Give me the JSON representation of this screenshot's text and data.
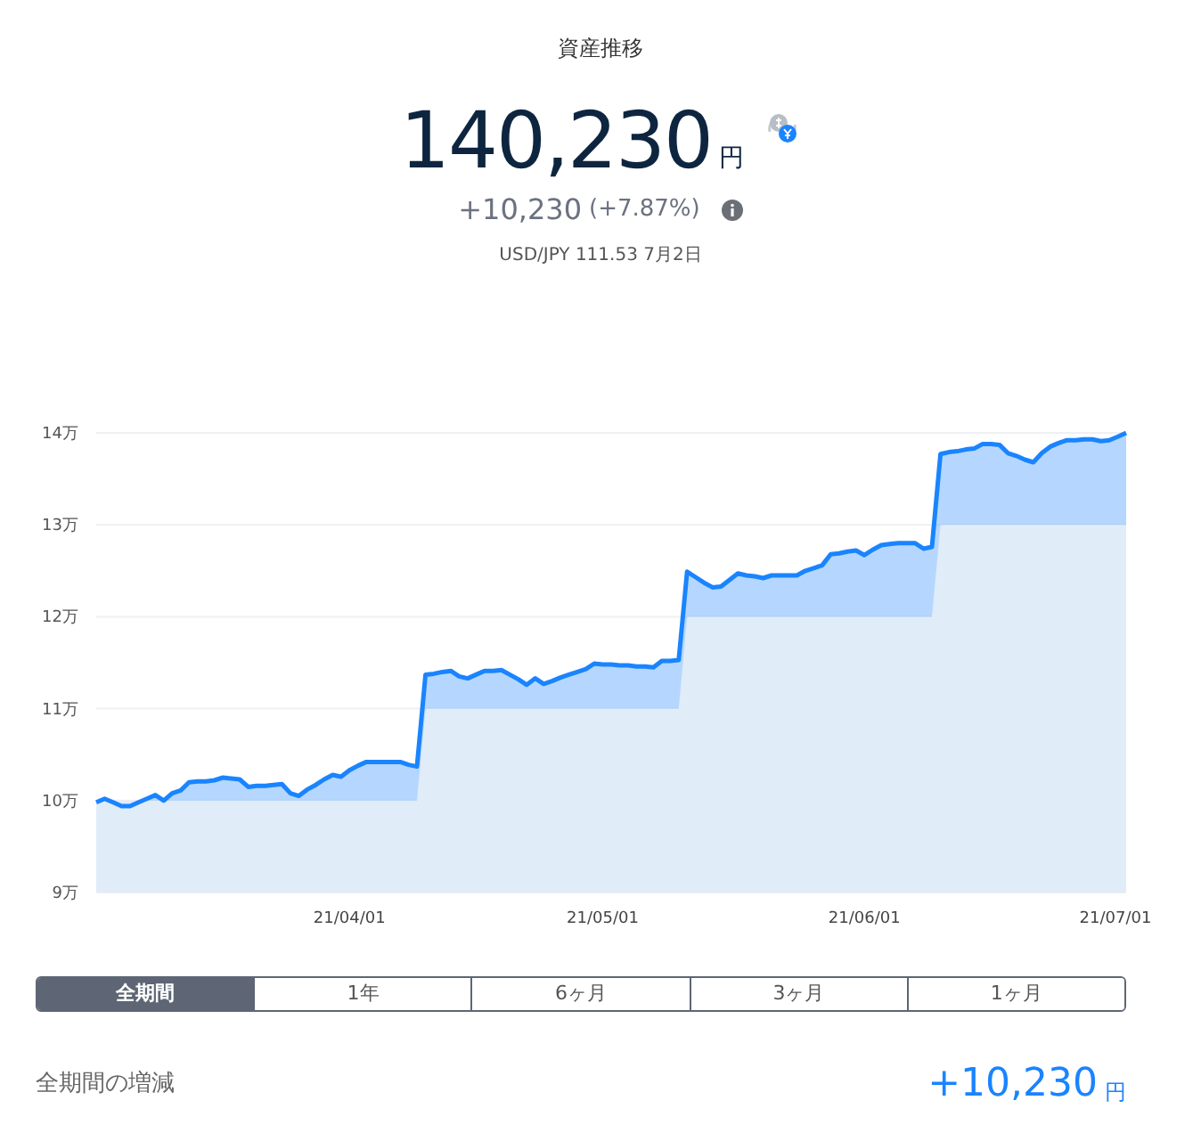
{
  "header": {
    "title": "資産推移",
    "total": "140,230",
    "total_unit": "円",
    "change": "+10,230",
    "change_pct": "(+7.87%)",
    "fx_rate": "USD/JPY 111.53 7月2日"
  },
  "chart": {
    "chart_data": {
      "type": "area",
      "categories": [
        null,
        null,
        null,
        null,
        null,
        null,
        null,
        null,
        null,
        null,
        null,
        null,
        null,
        null,
        null,
        null,
        null,
        null,
        null,
        null,
        null,
        null,
        null,
        null,
        null,
        null,
        null,
        null,
        null,
        null,
        "21/04/01",
        null,
        null,
        null,
        null,
        null,
        null,
        null,
        null,
        null,
        null,
        null,
        null,
        null,
        null,
        null,
        null,
        null,
        null,
        null,
        null,
        null,
        null,
        null,
        null,
        null,
        null,
        null,
        null,
        null,
        "21/05/01",
        null,
        null,
        null,
        null,
        null,
        null,
        null,
        null,
        null,
        null,
        null,
        null,
        null,
        null,
        null,
        null,
        null,
        null,
        null,
        null,
        null,
        null,
        null,
        null,
        null,
        null,
        null,
        null,
        null,
        null,
        "21/06/01",
        null,
        null,
        null,
        null,
        null,
        null,
        null,
        null,
        null,
        null,
        null,
        null,
        null,
        null,
        null,
        null,
        null,
        null,
        null,
        null,
        null,
        null,
        null,
        null,
        null,
        null,
        null,
        null,
        null,
        "21/07/01",
        null
      ],
      "series": [
        {
          "color": "#e1ecf9",
          "values": [
            10,
            10,
            10,
            10,
            10,
            10,
            10,
            10,
            10,
            10,
            10,
            10,
            10,
            10,
            10,
            10,
            10,
            10,
            10,
            10,
            10,
            10,
            10,
            10,
            10,
            10,
            10,
            10,
            10,
            10,
            10,
            10,
            10,
            10,
            10,
            10,
            10,
            10,
            10,
            11,
            11,
            11,
            11,
            11,
            11,
            11,
            11,
            11,
            11,
            11,
            11,
            11,
            11,
            11,
            11,
            11,
            11,
            11,
            11,
            11,
            11,
            11,
            11,
            11,
            11,
            11,
            11,
            11,
            11,
            11,
            12,
            12,
            12,
            12,
            12,
            12,
            12,
            12,
            12,
            12,
            12,
            12,
            12,
            12,
            12,
            12,
            12,
            12,
            12,
            12,
            12,
            12,
            12,
            12,
            12,
            12,
            12,
            12,
            12,
            12,
            13,
            13,
            13,
            13,
            13,
            13,
            13,
            13,
            13,
            13,
            13,
            13,
            13,
            13,
            13,
            13,
            13,
            13,
            13,
            13,
            13,
            13,
            13
          ]
        },
        {
          "color": "#1a84ff",
          "values": [
            9.98,
            10.02,
            9.98,
            9.94,
            9.94,
            9.98,
            10.02,
            10.06,
            10,
            10.08,
            10.11,
            10.2,
            10.21,
            10.21,
            10.22,
            10.25,
            10.24,
            10.23,
            10.15,
            10.16,
            10.16,
            10.17,
            10.18,
            10.08,
            10.05,
            10.12,
            10.17,
            10.23,
            10.28,
            10.26,
            10.33,
            10.38,
            10.42,
            10.42,
            10.42,
            10.42,
            10.42,
            10.39,
            10.37,
            11.37,
            11.38,
            11.4,
            11.41,
            11.35,
            11.33,
            11.37,
            11.41,
            11.41,
            11.42,
            11.37,
            11.32,
            11.26,
            11.33,
            11.27,
            11.3,
            11.34,
            11.37,
            11.4,
            11.43,
            11.49,
            11.48,
            11.48,
            11.47,
            11.47,
            11.46,
            11.46,
            11.45,
            11.52,
            11.52,
            11.53,
            12.49,
            12.43,
            12.37,
            12.32,
            12.33,
            12.4,
            12.47,
            12.45,
            12.44,
            12.42,
            12.45,
            12.45,
            12.45,
            12.45,
            12.5,
            12.53,
            12.56,
            12.68,
            12.69,
            12.71,
            12.72,
            12.67,
            12.73,
            12.78,
            12.79,
            12.8,
            12.8,
            12.8,
            12.74,
            12.76,
            13.77,
            13.79,
            13.8,
            13.82,
            13.83,
            13.88,
            13.88,
            13.87,
            13.78,
            13.75,
            13.71,
            13.68,
            13.78,
            13.85,
            13.89,
            13.92,
            13.92,
            13.93,
            13.93,
            13.91,
            13.92,
            13.96,
            14
          ]
        }
      ],
      "ylim": [
        9,
        14
      ],
      "grid": true,
      "yticks": [
        {
          "value": 14,
          "label": "14万"
        },
        {
          "value": 13,
          "label": "13万"
        },
        {
          "value": 12,
          "label": "12万"
        },
        {
          "value": 11,
          "label": "11万"
        },
        {
          "value": 10,
          "label": "10万"
        },
        {
          "value": 9,
          "label": "9万"
        }
      ]
    }
  },
  "periods": [
    {
      "label": "全期間",
      "selected": true
    },
    {
      "label": "1年",
      "selected": false
    },
    {
      "label": "6ヶ月",
      "selected": false
    },
    {
      "label": "3ヶ月",
      "selected": false
    },
    {
      "label": "1ヶ月",
      "selected": false
    }
  ],
  "summary": {
    "label": "全期間の増減",
    "value": "+10,230",
    "unit": "円"
  }
}
